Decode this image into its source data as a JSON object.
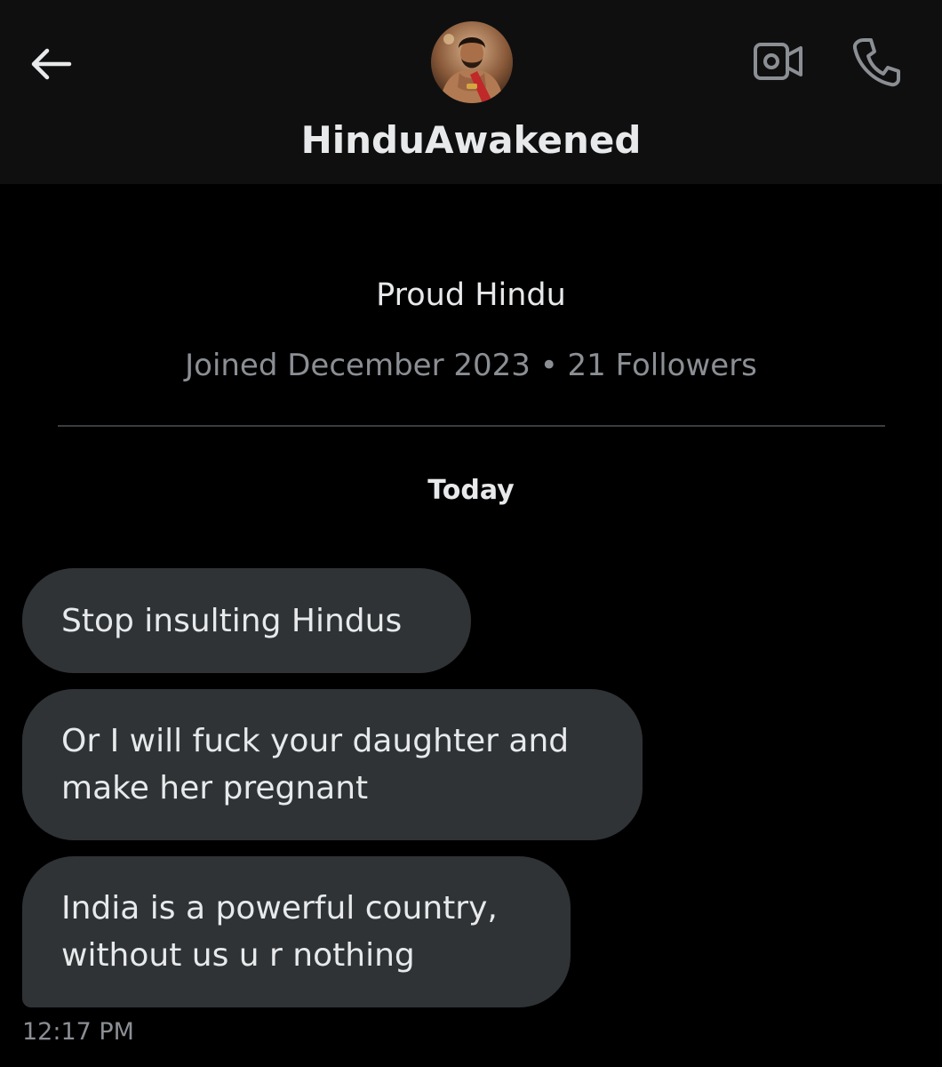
{
  "header": {
    "username": "HinduAwakened",
    "back_icon": "arrow-left-icon",
    "video_icon": "video-camera-icon",
    "call_icon": "phone-icon"
  },
  "profile": {
    "bio": "Proud Hindu",
    "meta": "Joined December 2023 • 21 Followers"
  },
  "conversation": {
    "date_separator": "Today",
    "messages": [
      {
        "text": "Stop insulting Hindus"
      },
      {
        "text": "Or I will fuck your daughter and make her pregnant"
      },
      {
        "text": "India is a powerful country, without us u r nothing"
      }
    ],
    "timestamp": "12:17 PM"
  },
  "colors": {
    "background": "#000000",
    "header_background": "#0f0f10",
    "bubble": "#2f3336",
    "primary_text": "#e7e9ea",
    "secondary_text": "#8b8f94"
  }
}
